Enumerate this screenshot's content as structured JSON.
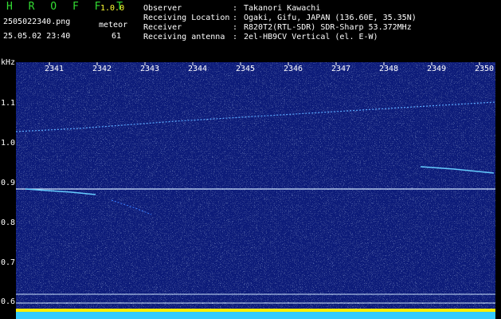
{
  "app": {
    "name": "H R O F F T",
    "version": "1.0.0"
  },
  "file": {
    "filename": "2505022340.png",
    "datetime": "25.05.02 23:40"
  },
  "meteor": {
    "label": "meteor",
    "count": "61"
  },
  "meta": [
    {
      "label": "Observer",
      "value": "Takanori Kawachi"
    },
    {
      "label": "Receiving Location",
      "value": "Ogaki, Gifu, JAPAN (136.60E, 35.35N)"
    },
    {
      "label": "Receiver",
      "value": "R820T2(RTL-SDR) SDR-Sharp 53.372MHz"
    },
    {
      "label": "Receiving antenna",
      "value": "2el-HB9CV Vertical (el. E-W)"
    }
  ],
  "axis": {
    "y_unit": "kHz",
    "y_ticks": [
      "1.1",
      "1.0",
      "0.9",
      "0.8",
      "0.7",
      "0.6"
    ],
    "x_ticks": [
      "2341",
      "2342",
      "2343",
      "2344",
      "2345",
      "2346",
      "2347",
      "2348",
      "2349",
      "2350"
    ]
  },
  "colors": {
    "background": "#0b1a7a",
    "trace": "#66ccff",
    "bottom_band": "#33ccff",
    "yellow_band": "#ffee00"
  }
}
